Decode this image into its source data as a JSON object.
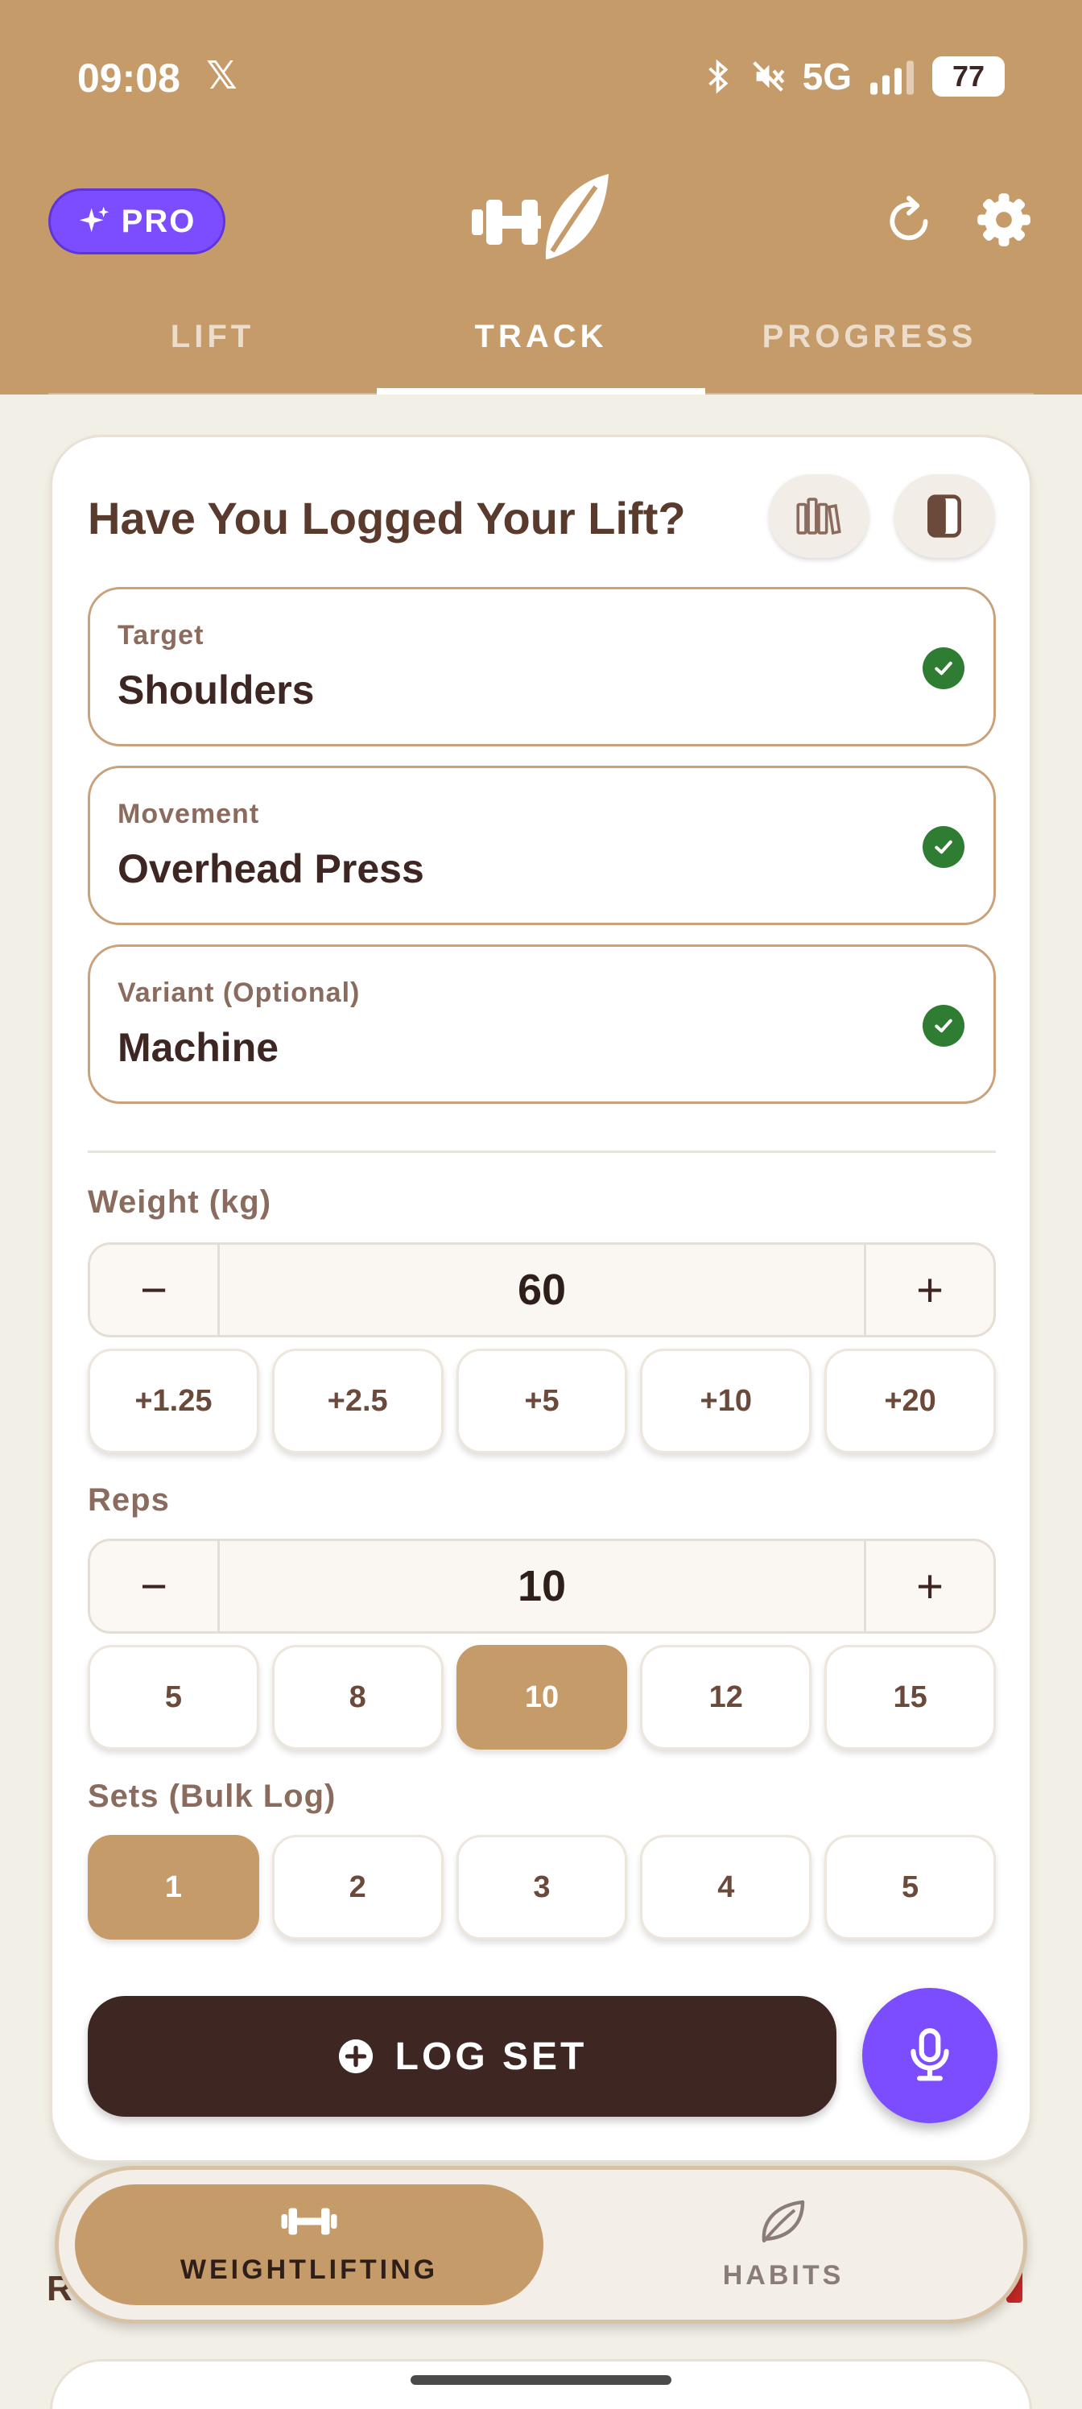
{
  "status_bar": {
    "time": "09:08",
    "x_logo": "𝕏",
    "network": "5G",
    "battery": "77"
  },
  "header": {
    "pro_label": "PRO",
    "tabs": [
      {
        "label": "LIFT",
        "active": false
      },
      {
        "label": "TRACK",
        "active": true
      },
      {
        "label": "PROGRESS",
        "active": false
      }
    ]
  },
  "card": {
    "title": "Have You Logged Your Lift?",
    "fields": [
      {
        "label": "Target",
        "value": "Shoulders"
      },
      {
        "label": "Movement",
        "value": "Overhead Press"
      },
      {
        "label": "Variant (Optional)",
        "value": "Machine"
      }
    ],
    "weight": {
      "label": "Weight (kg)",
      "value": "60",
      "minus": "−",
      "plus": "+",
      "increments": [
        "+1.25",
        "+2.5",
        "+5",
        "+10",
        "+20"
      ]
    },
    "reps": {
      "label": "Reps",
      "value": "10",
      "minus": "−",
      "plus": "+",
      "presets": [
        "5",
        "8",
        "10",
        "12",
        "15"
      ],
      "selected": "10"
    },
    "sets": {
      "label": "Sets (Bulk Log)",
      "options": [
        "1",
        "2",
        "3",
        "4",
        "5"
      ],
      "selected": "1"
    },
    "log_button_label": "LOG SET"
  },
  "peek": {
    "letter": "R"
  },
  "bottom_nav": {
    "items": [
      {
        "label": "WEIGHTLIFTING",
        "icon": "dumbbell-icon",
        "active": true
      },
      {
        "label": "HABITS",
        "icon": "leaf-icon",
        "active": false
      }
    ]
  },
  "colors": {
    "header_bg": "#C69B6A",
    "accent_purple": "#7C4DFF",
    "dark_brown": "#3E2723",
    "check_green": "#2E7D32",
    "page_bg": "#F2EFE6"
  }
}
